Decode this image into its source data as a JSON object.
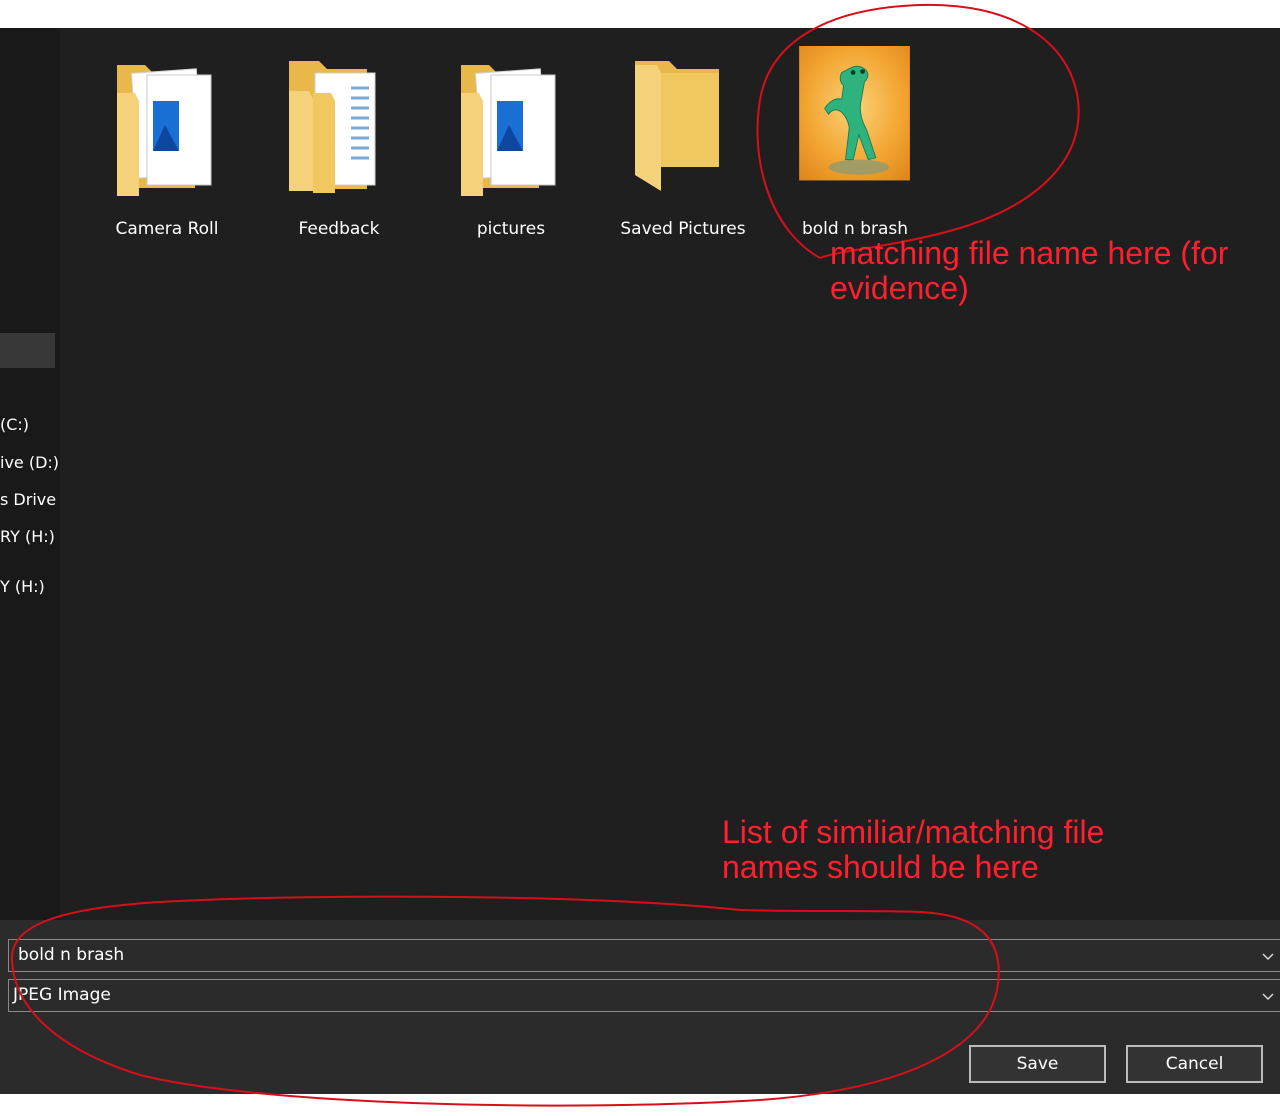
{
  "nav_items": [
    {
      "label": "(C:)"
    },
    {
      "label": "ive (D:)"
    },
    {
      "label": "s Drive ("
    },
    {
      "label": "RY (H:)"
    },
    {
      "label": "Y (H:)"
    }
  ],
  "files": [
    {
      "name": "Camera Roll",
      "icon": "folder-pictures-icon"
    },
    {
      "name": "Feedback",
      "icon": "folder-documents-icon"
    },
    {
      "name": "pictures",
      "icon": "folder-pictures-icon"
    },
    {
      "name": "Saved Pictures",
      "icon": "folder-icon"
    },
    {
      "name": "bold n brash",
      "icon": "image-thumbnail"
    }
  ],
  "filename_field": {
    "value": "bold n brash"
  },
  "filetype_field": {
    "value": "JPEG Image"
  },
  "buttons": {
    "save": "Save",
    "cancel": "Cancel"
  },
  "annotations": {
    "top_line1": "matching file name here (for",
    "top_line2": "evidence)",
    "bottom_line1": "List of similiar/matching file",
    "bottom_line2": "names should be here"
  },
  "colors": {
    "background": "#191919",
    "content": "#1f1f1f",
    "bottom_bar": "#2b2b2b",
    "folder": "#f5d17a",
    "annotation": "#ff1f2e"
  }
}
